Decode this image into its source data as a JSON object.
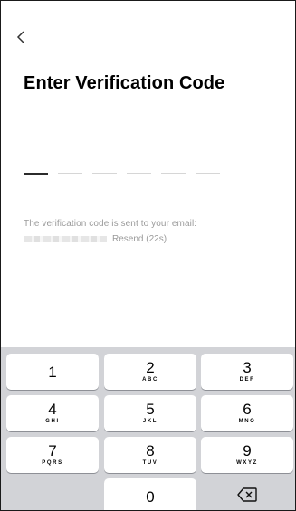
{
  "header": {
    "back_icon": "chevron-left-icon",
    "title": "Enter Verification Code"
  },
  "code": {
    "length": 6,
    "filled": 0
  },
  "info": {
    "line1": "The verification code is sent to your email:",
    "resend": "Resend (22s)"
  },
  "keypad": {
    "keys": [
      {
        "num": "1",
        "letters": ""
      },
      {
        "num": "2",
        "letters": "ABC"
      },
      {
        "num": "3",
        "letters": "DEF"
      },
      {
        "num": "4",
        "letters": "GHI"
      },
      {
        "num": "5",
        "letters": "JKL"
      },
      {
        "num": "6",
        "letters": "MNO"
      },
      {
        "num": "7",
        "letters": "PQRS"
      },
      {
        "num": "8",
        "letters": "TUV"
      },
      {
        "num": "9",
        "letters": "WXYZ"
      },
      {
        "num": "0",
        "letters": ""
      }
    ],
    "delete_icon": "backspace-icon",
    "colors": {
      "keyboard_bg": "#d2d3d7",
      "key_bg": "#ffffff"
    }
  }
}
